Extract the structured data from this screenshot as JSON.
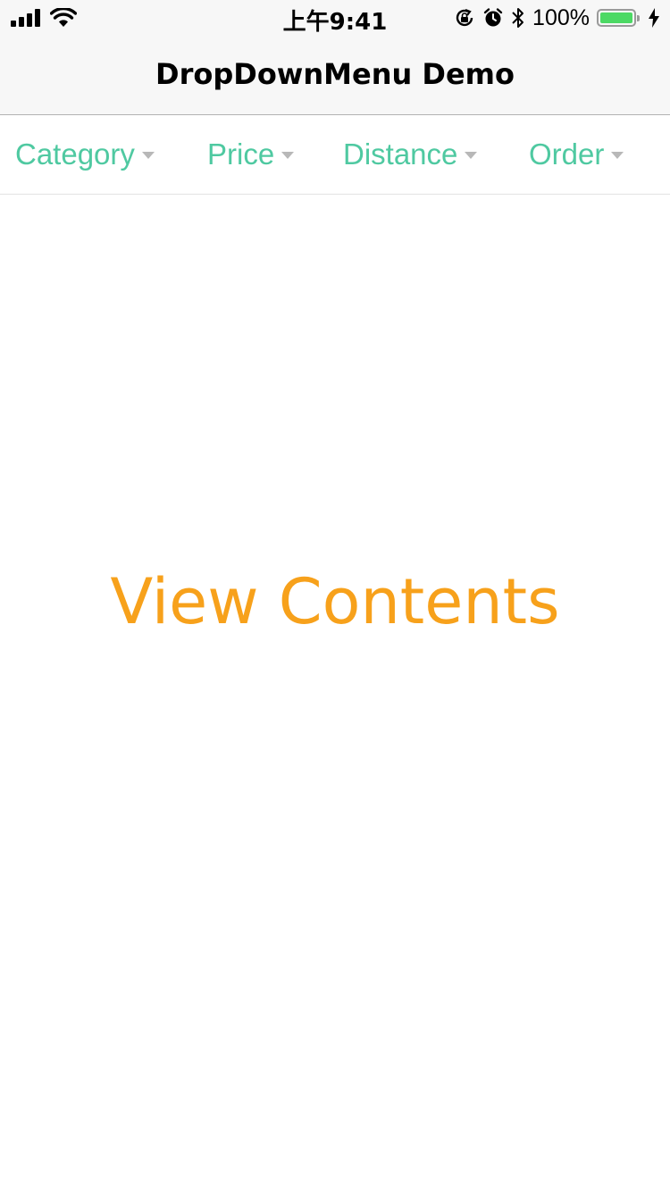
{
  "status_bar": {
    "time": "上午9:41",
    "battery_text": "100%",
    "icons": [
      "signal-icon",
      "wifi-icon",
      "rotation-lock-icon",
      "alarm-icon",
      "bluetooth-icon",
      "battery-icon",
      "charging-icon"
    ]
  },
  "nav": {
    "title": "DropDownMenu Demo"
  },
  "menu": {
    "items": [
      {
        "label": "Category"
      },
      {
        "label": "Price"
      },
      {
        "label": "Distance"
      },
      {
        "label": "Order"
      }
    ]
  },
  "content": {
    "text": "View Contents"
  },
  "colors": {
    "menu_text": "#4fc9a1",
    "content_text": "#f7a11b",
    "battery_fill": "#4cd964"
  }
}
